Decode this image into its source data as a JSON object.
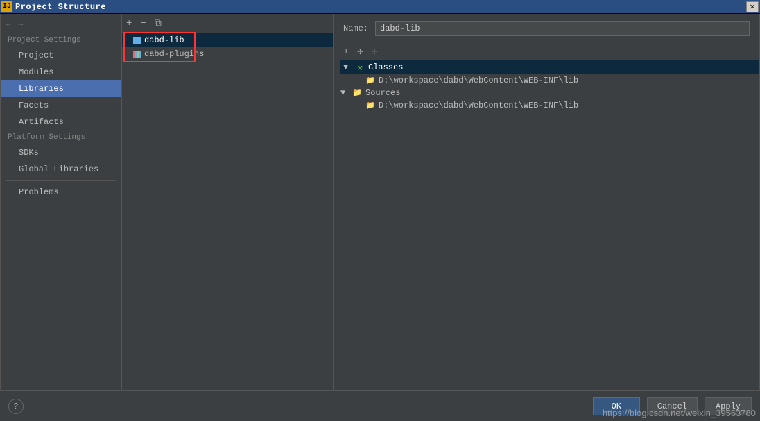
{
  "window": {
    "title": "Project Structure"
  },
  "leftPanel": {
    "section1": "Project Settings",
    "items1": [
      "Project",
      "Modules",
      "Libraries",
      "Facets",
      "Artifacts"
    ],
    "selected1": "Libraries",
    "section2": "Platform Settings",
    "items2": [
      "SDKs",
      "Global Libraries"
    ],
    "section3_items": [
      "Problems"
    ]
  },
  "midPanel": {
    "libs": [
      "dabd-lib",
      "dabd-plugins"
    ],
    "selected": "dabd-lib"
  },
  "rightPanel": {
    "nameLabel": "Name:",
    "nameValue": "dabd-lib",
    "tree": {
      "classes": {
        "label": "Classes",
        "path": "D:\\workspace\\dabd\\WebContent\\WEB-INF\\lib"
      },
      "sources": {
        "label": "Sources",
        "path": "D:\\workspace\\dabd\\WebContent\\WEB-INF\\lib"
      }
    }
  },
  "footer": {
    "ok": "OK",
    "cancel": "Cancel",
    "apply": "Apply"
  },
  "watermark": "https://blog.csdn.net/weixin_39563780"
}
